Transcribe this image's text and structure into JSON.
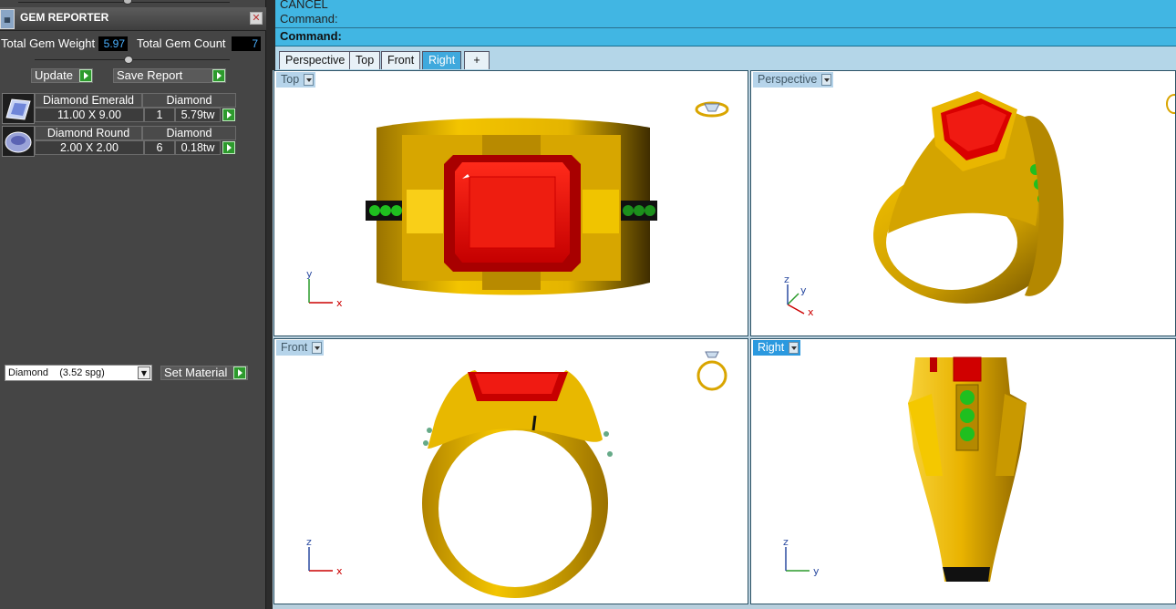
{
  "panel": {
    "title": "GEM REPORTER",
    "total_weight_label": "Total Gem Weight",
    "total_weight_value": "5.97",
    "total_count_label": "Total Gem Count",
    "total_count_value": "7",
    "update_label": "Update",
    "save_report_label": "Save Report",
    "gems": [
      {
        "name": "Diamond Emerald",
        "material": "Diamond",
        "size": "11.00 X 9.00",
        "qty": "1",
        "weight": "5.79tw",
        "icon": "emerald-cut-gem-icon"
      },
      {
        "name": "Diamond Round",
        "material": "Diamond",
        "size": "2.00 X 2.00",
        "qty": "6",
        "weight": "0.18tw",
        "icon": "round-cut-gem-icon"
      }
    ],
    "material_select": "Diamond    (3.52 spg)",
    "set_material_label": "Set Material"
  },
  "command": {
    "line1": "CANCEL",
    "line2": "Command:",
    "prompt": "Command:"
  },
  "tabs": [
    {
      "label": "Perspective"
    },
    {
      "label": "Top"
    },
    {
      "label": "Front"
    },
    {
      "label": "Right",
      "active": true
    },
    {
      "label": "+"
    }
  ],
  "viewports": {
    "top": "Top",
    "perspective": "Perspective",
    "front": "Front",
    "right": "Right"
  },
  "axes": {
    "x": "x",
    "y": "y",
    "z": "z"
  },
  "colors": {
    "command_bg": "#41b6e3",
    "gold": "#e0b000",
    "ruby": "#e41010",
    "emerald_green": "#1fbf1f",
    "active_tab": "#3fa9dd"
  }
}
